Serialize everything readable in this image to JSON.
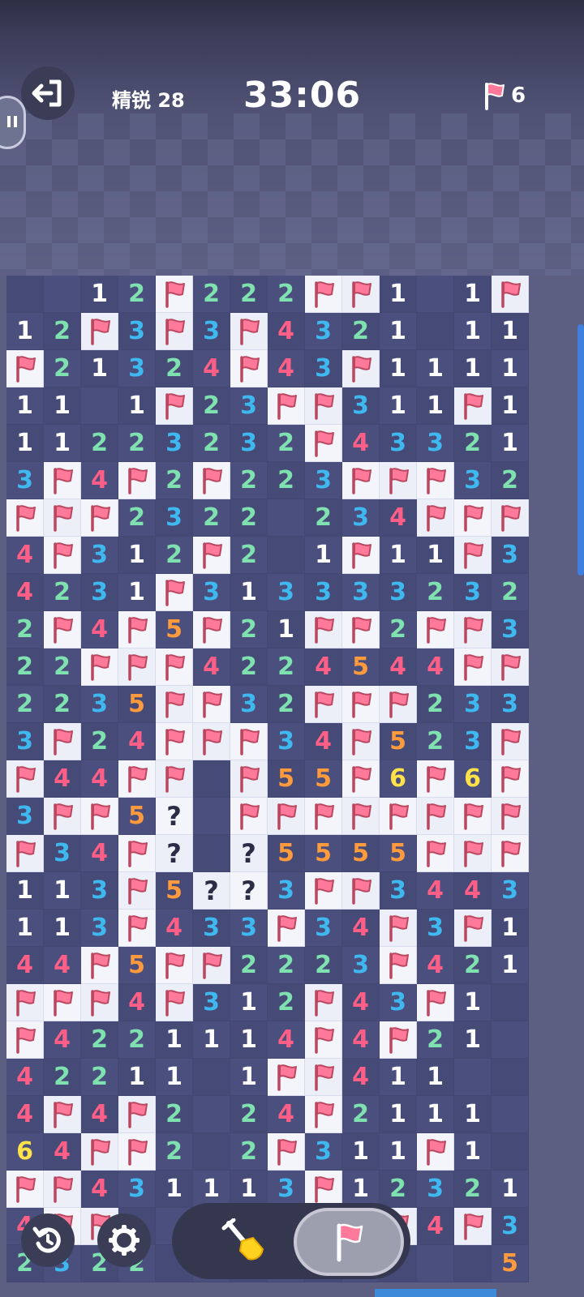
{
  "header": {
    "level_label": "精锐 28",
    "timer": "33:06",
    "flags_remaining": "6"
  },
  "icons": {
    "exit": "exit-icon",
    "pause": "pause-icon",
    "flag": "flag-icon",
    "restart": "restart-icon",
    "settings": "gear-icon",
    "dig": "shovel-icon"
  },
  "colors": {
    "n1": "#ffffff",
    "n2": "#7fe0b0",
    "n3": "#3fb8f0",
    "n4": "#ff5f86",
    "n5": "#ff9a3d",
    "n6": "#ffe24a",
    "flag": "#ff7a9a"
  },
  "board": {
    "legend": "F = flag, ? = question mark, . = blank revealed, digits = mine count",
    "rows": [
      "..12F222FF1.1F",
      "12F3F3F4321.11",
      "F21324F43F1111",
      "11.1F23FF311F1",
      "11223232F43321",
      "3F4F2F223FFF32",
      "FFF2322.234FFF",
      "4F312F2.1F11F3F",
      "4231F313333232",
      "2F4F5F21FF2FF3",
      "22FFF4224544FF",
      "2235FF32FFF233",
      "3F24FFF34F523F",
      "F44FF.F55F6F6F",
      "3FF5?.FFFFFFFF",
      "F34F?.?5555FFF",
      "113F5??3FF3443",
      "113F433F34F3F1",
      "44F5FF2223F421",
      "FFF4F312F43F1.",
      "F4221114F4F21.",
      "42211.1FF411..",
      "4F4F2.24F2111.",
      "64FF2.2F311F1.",
      "FF431113F12321",
      "4FF.......F4F3",
      "2322....2....5FF"
    ]
  }
}
